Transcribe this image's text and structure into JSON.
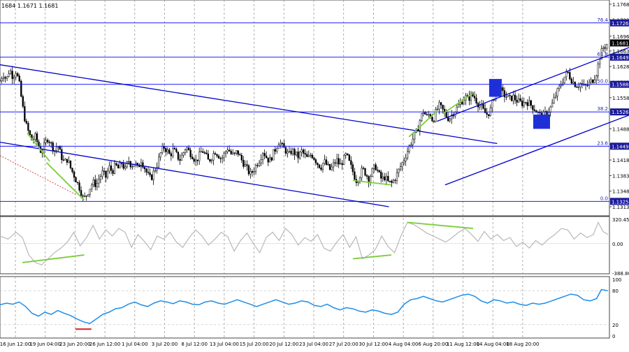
{
  "window": {
    "ohlc_header": "1684 1.1671 1.1681"
  },
  "colors": {
    "candle": "#000000",
    "level_line": "#1a1aff",
    "fib_line": "#2222aa",
    "channel": "#0000cc",
    "highlight_box": "#1f2fd8",
    "green_line": "#7ccd3a",
    "red_mark": "#d62020",
    "cci_line": "#b8b8b8",
    "rsi_line": "#1e8ee8",
    "grid": "#9a9a9a",
    "price_badge": "#000000"
  },
  "chart_data": [
    {
      "type": "candlestick",
      "name": "price",
      "ylim": [
        1.1313,
        1.1768
      ],
      "y_ticks": [
        "1.1768",
        "1.1733",
        "1.1696",
        "1.1663",
        "1.1628",
        "1.1593",
        "1.1558",
        "1.1523",
        "1.1488",
        "1.1453",
        "1.1418",
        "1.1383",
        "1.1348",
        "1.1313"
      ],
      "x_ticks": [
        "16 Jun 12:00",
        "19 Jun 04:00",
        "23 Jun 20:00",
        "26 Jun 12:00",
        "1 Jul 04:00",
        "3 Jul 20:00",
        "8 Jul 12:00",
        "13 Jul 04:00",
        "15 Jul 20:00",
        "20 Jul 12:00",
        "23 Jul 04:00",
        "27 Jul 20:00",
        "30 Jul 12:00",
        "4 Aug 04:00",
        "6 Aug 20:00",
        "11 Aug 12:00",
        "14 Aug 04:00",
        "18 Aug 20:00"
      ],
      "current_price": "1.1681",
      "fib_levels": [
        {
          "label": "76.4",
          "value": 1.1726,
          "badge": "1.1726"
        },
        {
          "label": "61.8",
          "value": 1.1649,
          "badge": "1.1649"
        },
        {
          "label": "50.0",
          "value": 1.1588,
          "badge": "1.1588"
        },
        {
          "label": "38.2",
          "value": 1.1526,
          "badge": "1.1526"
        },
        {
          "label": "23.6",
          "value": 1.1449,
          "badge": "1.1449"
        },
        {
          "label": "0.0",
          "value": 1.1325,
          "badge": "1.1325"
        }
      ],
      "close_path": [
        [
          0,
          1.1596
        ],
        [
          4,
          1.1612
        ],
        [
          8,
          1.1598
        ],
        [
          12,
          1.1622
        ],
        [
          16,
          1.1605
        ],
        [
          20,
          1.1618
        ],
        [
          24,
          1.159
        ],
        [
          28,
          1.154
        ],
        [
          32,
          1.15
        ],
        [
          36,
          1.1478
        ],
        [
          40,
          1.1462
        ],
        [
          44,
          1.147
        ],
        [
          48,
          1.145
        ],
        [
          52,
          1.1433
        ],
        [
          56,
          1.1455
        ],
        [
          60,
          1.1468
        ],
        [
          64,
          1.1452
        ],
        [
          68,
          1.144
        ],
        [
          72,
          1.1452
        ],
        [
          76,
          1.1428
        ],
        [
          80,
          1.1412
        ],
        [
          84,
          1.142
        ],
        [
          88,
          1.14
        ],
        [
          92,
          1.1385
        ],
        [
          96,
          1.1368
        ],
        [
          100,
          1.1352
        ],
        [
          104,
          1.133
        ],
        [
          108,
          1.134
        ],
        [
          112,
          1.1355
        ],
        [
          116,
          1.1368
        ],
        [
          120,
          1.1362
        ],
        [
          124,
          1.1378
        ],
        [
          128,
          1.139
        ],
        [
          132,
          1.138
        ],
        [
          136,
          1.1402
        ],
        [
          140,
          1.1392
        ],
        [
          144,
          1.1406
        ],
        [
          148,
          1.1398
        ],
        [
          152,
          1.1412
        ],
        [
          156,
          1.1395
        ],
        [
          160,
          1.1418
        ],
        [
          164,
          1.1405
        ],
        [
          168,
          1.1412
        ],
        [
          172,
          1.1398
        ],
        [
          176,
          1.1418
        ],
        [
          180,
          1.1402
        ],
        [
          184,
          1.1385
        ],
        [
          188,
          1.1375
        ],
        [
          192,
          1.1392
        ],
        [
          196,
          1.1408
        ],
        [
          200,
          1.1432
        ],
        [
          204,
          1.1448
        ],
        [
          208,
          1.144
        ],
        [
          212,
          1.1428
        ],
        [
          216,
          1.1442
        ],
        [
          220,
          1.143
        ],
        [
          224,
          1.1418
        ],
        [
          228,
          1.1432
        ],
        [
          232,
          1.1448
        ],
        [
          236,
          1.1436
        ],
        [
          240,
          1.1428
        ],
        [
          244,
          1.1415
        ],
        [
          248,
          1.1426
        ],
        [
          252,
          1.144
        ],
        [
          256,
          1.143
        ],
        [
          260,
          1.1415
        ],
        [
          264,
          1.1425
        ],
        [
          268,
          1.1438
        ],
        [
          272,
          1.143
        ],
        [
          276,
          1.142
        ],
        [
          280,
          1.1432
        ],
        [
          284,
          1.1445
        ],
        [
          288,
          1.1432
        ],
        [
          292,
          1.1428
        ],
        [
          296,
          1.1438
        ],
        [
          300,
          1.1422
        ],
        [
          304,
          1.141
        ],
        [
          308,
          1.1398
        ],
        [
          312,
          1.1385
        ],
        [
          316,
          1.1395
        ],
        [
          320,
          1.1408
        ],
        [
          324,
          1.142
        ],
        [
          328,
          1.1438
        ],
        [
          332,
          1.1425
        ],
        [
          336,
          1.1415
        ],
        [
          340,
          1.143
        ],
        [
          344,
          1.1445
        ],
        [
          348,
          1.146
        ],
        [
          352,
          1.1448
        ],
        [
          356,
          1.144
        ],
        [
          360,
          1.1428
        ],
        [
          364,
          1.144
        ],
        [
          368,
          1.1432
        ],
        [
          372,
          1.1425
        ],
        [
          376,
          1.1438
        ],
        [
          380,
          1.1428
        ],
        [
          384,
          1.142
        ],
        [
          388,
          1.1432
        ],
        [
          392,
          1.1422
        ],
        [
          396,
          1.141
        ],
        [
          400,
          1.1402
        ],
        [
          404,
          1.1415
        ],
        [
          408,
          1.1405
        ],
        [
          412,
          1.1395
        ],
        [
          416,
          1.1408
        ],
        [
          420,
          1.1418
        ],
        [
          424,
          1.1405
        ],
        [
          428,
          1.1418
        ],
        [
          432,
          1.143
        ],
        [
          436,
          1.141
        ],
        [
          440,
          1.1392
        ],
        [
          444,
          1.1372
        ],
        [
          448,
          1.138
        ],
        [
          452,
          1.1398
        ],
        [
          456,
          1.1388
        ],
        [
          460,
          1.1375
        ],
        [
          464,
          1.1392
        ],
        [
          468,
          1.1405
        ],
        [
          472,
          1.1388
        ],
        [
          476,
          1.1374
        ],
        [
          480,
          1.138
        ],
        [
          484,
          1.1368
        ],
        [
          488,
          1.1365
        ],
        [
          492,
          1.1375
        ],
        [
          496,
          1.139
        ],
        [
          500,
          1.1405
        ],
        [
          504,
          1.142
        ],
        [
          508,
          1.1438
        ],
        [
          512,
          1.1455
        ],
        [
          516,
          1.147
        ],
        [
          520,
          1.1482
        ],
        [
          524,
          1.151
        ],
        [
          528,
          1.1528
        ],
        [
          532,
          1.1515
        ],
        [
          536,
          1.1522
        ],
        [
          540,
          1.1505
        ],
        [
          544,
          1.1528
        ],
        [
          548,
          1.154
        ],
        [
          552,
          1.153
        ],
        [
          556,
          1.1518
        ],
        [
          560,
          1.151
        ],
        [
          564,
          1.1522
        ],
        [
          568,
          1.153
        ],
        [
          572,
          1.154
        ],
        [
          576,
          1.155
        ],
        [
          580,
          1.156
        ],
        [
          584,
          1.1555
        ],
        [
          588,
          1.1565
        ],
        [
          592,
          1.1558
        ],
        [
          596,
          1.1545
        ],
        [
          600,
          1.1538
        ],
        [
          604,
          1.1525
        ],
        [
          608,
          1.152
        ],
        [
          612,
          1.1532
        ],
        [
          616,
          1.156
        ],
        [
          620,
          1.1585
        ],
        [
          624,
          1.1575
        ],
        [
          628,
          1.1565
        ],
        [
          632,
          1.156
        ],
        [
          636,
          1.1555
        ],
        [
          640,
          1.156
        ],
        [
          644,
          1.1552
        ],
        [
          648,
          1.1548
        ],
        [
          652,
          1.1545
        ],
        [
          656,
          1.155
        ],
        [
          660,
          1.1545
        ],
        [
          664,
          1.1538
        ],
        [
          668,
          1.153
        ],
        [
          672,
          1.152
        ],
        [
          676,
          1.1515
        ],
        [
          680,
          1.1522
        ],
        [
          684,
          1.1528
        ],
        [
          688,
          1.154
        ],
        [
          692,
          1.156
        ],
        [
          696,
          1.1575
        ],
        [
          700,
          1.159
        ],
        [
          704,
          1.1605
        ],
        [
          708,
          1.1615
        ],
        [
          712,
          1.16
        ],
        [
          716,
          1.159
        ],
        [
          720,
          1.1585
        ],
        [
          724,
          1.159
        ],
        [
          728,
          1.1582
        ],
        [
          732,
          1.1585
        ],
        [
          736,
          1.1592
        ],
        [
          740,
          1.16
        ],
        [
          744,
          1.1615
        ],
        [
          748,
          1.165
        ],
        [
          752,
          1.167
        ],
        [
          756,
          1.1676
        ],
        [
          758,
          1.1681
        ]
      ]
    },
    {
      "type": "line",
      "name": "oscillator",
      "y_ticks": [
        "320.4558",
        "0.00",
        "-388.8032"
      ],
      "ylim": [
        -388.8032,
        320.4558
      ],
      "x": [
        0,
        10,
        20,
        28,
        36,
        44,
        52,
        60,
        68,
        76,
        84,
        92,
        100,
        108,
        116,
        124,
        132,
        140,
        148,
        156,
        164,
        172,
        180,
        188,
        196,
        204,
        212,
        220,
        228,
        236,
        244,
        252,
        260,
        268,
        276,
        284,
        292,
        300,
        308,
        316,
        324,
        332,
        340,
        348,
        356,
        364,
        372,
        380,
        388,
        396,
        404,
        412,
        420,
        428,
        436,
        444,
        452,
        460,
        468,
        476,
        484,
        492,
        500,
        508,
        516,
        524,
        532,
        540,
        548,
        556,
        564,
        572,
        580,
        588,
        596,
        604,
        612,
        620,
        628,
        636,
        644,
        652,
        660,
        668,
        676,
        684,
        692,
        700,
        708,
        716,
        724,
        732,
        740,
        746,
        752,
        758
      ],
      "values": [
        100,
        60,
        150,
        80,
        -150,
        -250,
        -280,
        -200,
        -120,
        -60,
        20,
        150,
        -30,
        80,
        240,
        60,
        180,
        100,
        200,
        150,
        -50,
        120,
        30,
        -80,
        100,
        60,
        150,
        20,
        -50,
        80,
        180,
        100,
        -20,
        60,
        150,
        90,
        -100,
        40,
        140,
        0,
        -120,
        80,
        150,
        40,
        200,
        120,
        -20,
        80,
        30,
        120,
        -60,
        -100,
        20,
        120,
        -50,
        90,
        -200,
        -150,
        -80,
        100,
        -40,
        -120,
        100,
        280,
        250,
        200,
        140,
        100,
        60,
        20,
        80,
        150,
        200,
        120,
        30,
        160,
        60,
        120,
        40,
        80,
        -40,
        20,
        -60,
        40,
        -20,
        60,
        120,
        200,
        180,
        60,
        140,
        80,
        120,
        280,
        160,
        120
      ]
    },
    {
      "type": "line",
      "name": "rsi",
      "y_ticks": [
        "100",
        "80",
        "20",
        "0"
      ],
      "ylim": [
        0,
        100
      ],
      "x": [
        0,
        8,
        16,
        24,
        32,
        40,
        48,
        56,
        64,
        72,
        80,
        88,
        96,
        104,
        112,
        120,
        128,
        136,
        144,
        152,
        160,
        168,
        176,
        184,
        192,
        200,
        208,
        216,
        224,
        232,
        240,
        248,
        256,
        264,
        272,
        280,
        288,
        296,
        304,
        312,
        320,
        328,
        336,
        344,
        352,
        360,
        368,
        376,
        384,
        392,
        400,
        408,
        416,
        424,
        432,
        440,
        448,
        456,
        464,
        472,
        480,
        488,
        496,
        504,
        512,
        520,
        528,
        536,
        544,
        552,
        560,
        568,
        576,
        584,
        592,
        600,
        608,
        616,
        624,
        632,
        640,
        648,
        656,
        664,
        672,
        680,
        688,
        696,
        704,
        712,
        720,
        728,
        736,
        744,
        750,
        758
      ],
      "values": [
        55,
        58,
        56,
        60,
        52,
        40,
        35,
        42,
        38,
        45,
        40,
        36,
        30,
        25,
        22,
        30,
        38,
        42,
        48,
        50,
        56,
        60,
        55,
        52,
        58,
        62,
        60,
        57,
        62,
        60,
        56,
        55,
        60,
        62,
        58,
        56,
        60,
        64,
        60,
        56,
        52,
        56,
        60,
        64,
        60,
        56,
        58,
        62,
        60,
        54,
        52,
        56,
        50,
        46,
        50,
        48,
        44,
        42,
        46,
        44,
        40,
        38,
        42,
        56,
        64,
        66,
        70,
        66,
        62,
        60,
        64,
        68,
        72,
        74,
        70,
        62,
        58,
        64,
        62,
        58,
        60,
        56,
        54,
        58,
        56,
        58,
        62,
        66,
        70,
        74,
        72,
        64,
        62,
        66,
        82,
        80
      ]
    }
  ]
}
